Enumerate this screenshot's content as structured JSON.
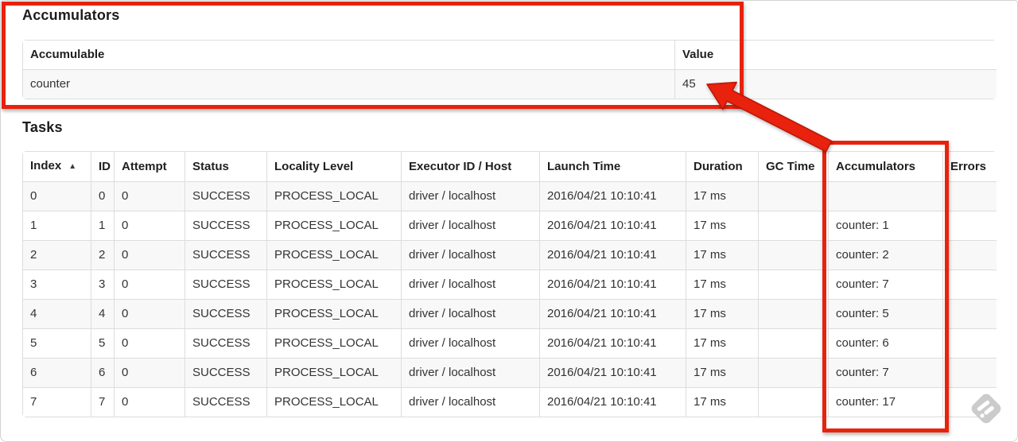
{
  "accumulators_section": {
    "title": "Accumulators",
    "table": {
      "headers": [
        "Accumulable",
        "Value"
      ],
      "rows": [
        [
          "counter",
          "45"
        ]
      ]
    }
  },
  "tasks_section": {
    "title": "Tasks",
    "table": {
      "headers": [
        "Index",
        "ID",
        "Attempt",
        "Status",
        "Locality Level",
        "Executor ID / Host",
        "Launch Time",
        "Duration",
        "GC Time",
        "Accumulators",
        "Errors"
      ],
      "sort": {
        "column_index": 0,
        "direction": "ascending",
        "icon": "▲"
      },
      "rows": [
        [
          "0",
          "0",
          "0",
          "SUCCESS",
          "PROCESS_LOCAL",
          "driver / localhost",
          "2016/04/21 10:10:41",
          "17 ms",
          "",
          "",
          ""
        ],
        [
          "1",
          "1",
          "0",
          "SUCCESS",
          "PROCESS_LOCAL",
          "driver / localhost",
          "2016/04/21 10:10:41",
          "17 ms",
          "",
          "counter: 1",
          ""
        ],
        [
          "2",
          "2",
          "0",
          "SUCCESS",
          "PROCESS_LOCAL",
          "driver / localhost",
          "2016/04/21 10:10:41",
          "17 ms",
          "",
          "counter: 2",
          ""
        ],
        [
          "3",
          "3",
          "0",
          "SUCCESS",
          "PROCESS_LOCAL",
          "driver / localhost",
          "2016/04/21 10:10:41",
          "17 ms",
          "",
          "counter: 7",
          ""
        ],
        [
          "4",
          "4",
          "0",
          "SUCCESS",
          "PROCESS_LOCAL",
          "driver / localhost",
          "2016/04/21 10:10:41",
          "17 ms",
          "",
          "counter: 5",
          ""
        ],
        [
          "5",
          "5",
          "0",
          "SUCCESS",
          "PROCESS_LOCAL",
          "driver / localhost",
          "2016/04/21 10:10:41",
          "17 ms",
          "",
          "counter: 6",
          ""
        ],
        [
          "6",
          "6",
          "0",
          "SUCCESS",
          "PROCESS_LOCAL",
          "driver / localhost",
          "2016/04/21 10:10:41",
          "17 ms",
          "",
          "counter: 7",
          ""
        ],
        [
          "7",
          "7",
          "0",
          "SUCCESS",
          "PROCESS_LOCAL",
          "driver / localhost",
          "2016/04/21 10:10:41",
          "17 ms",
          "",
          "counter: 17",
          ""
        ]
      ]
    }
  },
  "annotations": {
    "highlight_color": "#e8220d",
    "arrow_outline_color": "#bd1605"
  },
  "watermark": {
    "icon": "feeder-logo",
    "color": "#c9c9c9"
  }
}
